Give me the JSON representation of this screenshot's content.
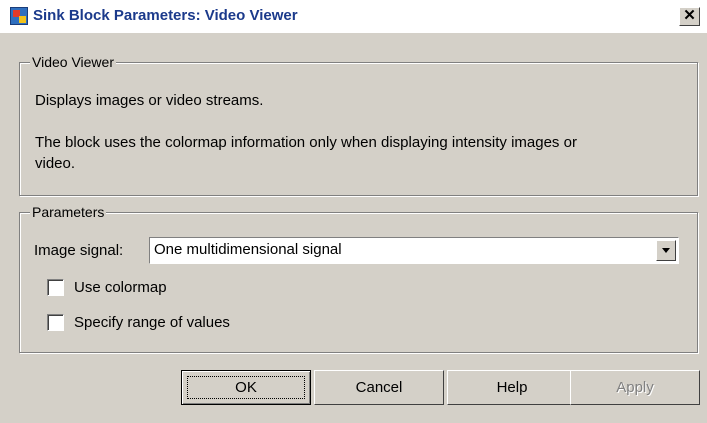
{
  "window": {
    "title": "Sink Block Parameters: Video Viewer",
    "close_glyph": "✕"
  },
  "description_group": {
    "legend": "Video Viewer",
    "line1": "Displays images or video streams.",
    "line2": "The block uses the colormap information only when displaying intensity images or",
    "line3": "video."
  },
  "parameters_group": {
    "legend": "Parameters",
    "image_signal_label": "Image signal:",
    "image_signal_value": "One multidimensional signal",
    "use_colormap_label": "Use colormap",
    "use_colormap_checked": false,
    "specify_range_label": "Specify range of values",
    "specify_range_checked": false
  },
  "buttons": {
    "ok": "OK",
    "cancel": "Cancel",
    "help": "Help",
    "apply": "Apply"
  },
  "icons": {
    "window_icon": "simulink-block-icon",
    "close_icon": "close-icon",
    "dropdown_icon": "chevron-down-icon"
  }
}
